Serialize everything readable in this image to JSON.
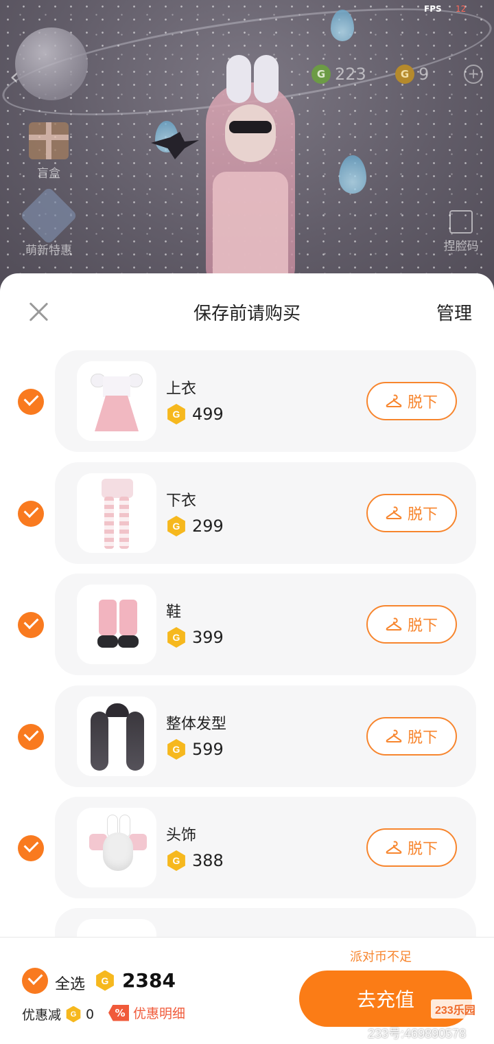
{
  "hud": {
    "fps_label": "FPS",
    "fps_value": "12",
    "currency_green": "223",
    "currency_gold": "9",
    "blind_box_label": "盲盒",
    "newbie_deal_label": "萌新特惠",
    "fit_code_label": "捏脸码"
  },
  "sheet": {
    "title": "保存前请购买",
    "manage_label": "管理",
    "take_off_label": "脱下",
    "items": [
      {
        "name": "上衣",
        "price": "499"
      },
      {
        "name": "下衣",
        "price": "299"
      },
      {
        "name": "鞋",
        "price": "399"
      },
      {
        "name": "整体发型",
        "price": "599"
      },
      {
        "name": "头饰",
        "price": "388"
      }
    ]
  },
  "footer": {
    "select_all_label": "全选",
    "total": "2384",
    "discount_label": "优惠减",
    "discount_value": "0",
    "discount_detail_label": "优惠明细",
    "insufficient_label": "派对币不足",
    "recharge_label": "去充值"
  },
  "watermark": {
    "logo": "233乐园",
    "id": "233号:469890578"
  },
  "colors": {
    "accent": "#f97a1f",
    "coin": "#f6b81e",
    "discount_red": "#f05a3a"
  },
  "icons": {
    "close": "close-icon",
    "check": "check-icon",
    "hanger": "hanger-icon",
    "coin": "coin-icon"
  }
}
